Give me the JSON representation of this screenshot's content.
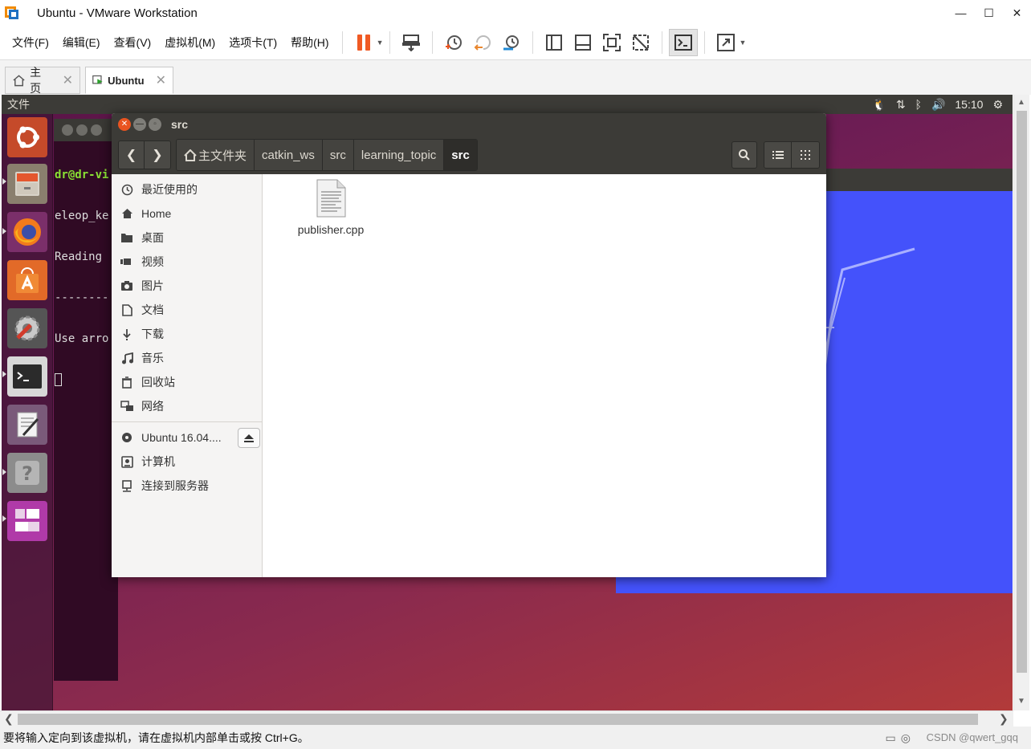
{
  "window": {
    "title": "Ubuntu - VMware Workstation"
  },
  "menu": [
    "文件(F)",
    "编辑(E)",
    "查看(V)",
    "虚拟机(M)",
    "选项卡(T)",
    "帮助(H)"
  ],
  "tabs": [
    {
      "label": "主页"
    },
    {
      "label": "Ubuntu"
    }
  ],
  "guest": {
    "topbar_label": "文件",
    "clock": "15:10"
  },
  "terminal": {
    "lines": [
      "dr@dr-vi",
      "eleop_ke",
      "Reading ",
      "--------",
      "Use arro"
    ]
  },
  "files": {
    "title": "src",
    "breadcrumbs": [
      "主文件夹",
      "catkin_ws",
      "src",
      "learning_topic",
      "src"
    ],
    "sidebar": [
      {
        "label": "最近使用的",
        "icon": "clock-icon"
      },
      {
        "label": "Home",
        "icon": "home-icon"
      },
      {
        "label": "桌面",
        "icon": "folder-icon"
      },
      {
        "label": "视频",
        "icon": "video-icon"
      },
      {
        "label": "图片",
        "icon": "camera-icon"
      },
      {
        "label": "文档",
        "icon": "document-icon"
      },
      {
        "label": "下载",
        "icon": "download-icon"
      },
      {
        "label": "音乐",
        "icon": "music-icon"
      },
      {
        "label": "回收站",
        "icon": "trash-icon"
      },
      {
        "label": "网络",
        "icon": "network-icon"
      }
    ],
    "devices": [
      {
        "label": "Ubuntu 16.04....",
        "icon": "disc-icon"
      },
      {
        "label": "计算机",
        "icon": "computer-icon"
      },
      {
        "label": "连接到服务器",
        "icon": "server-icon"
      }
    ],
    "items": [
      {
        "name": "publisher.cpp"
      }
    ]
  },
  "status": {
    "message": "要将输入定向到该虚拟机，请在虚拟机内部单击或按 Ctrl+G。",
    "watermark": "CSDN @qwert_gqq"
  }
}
